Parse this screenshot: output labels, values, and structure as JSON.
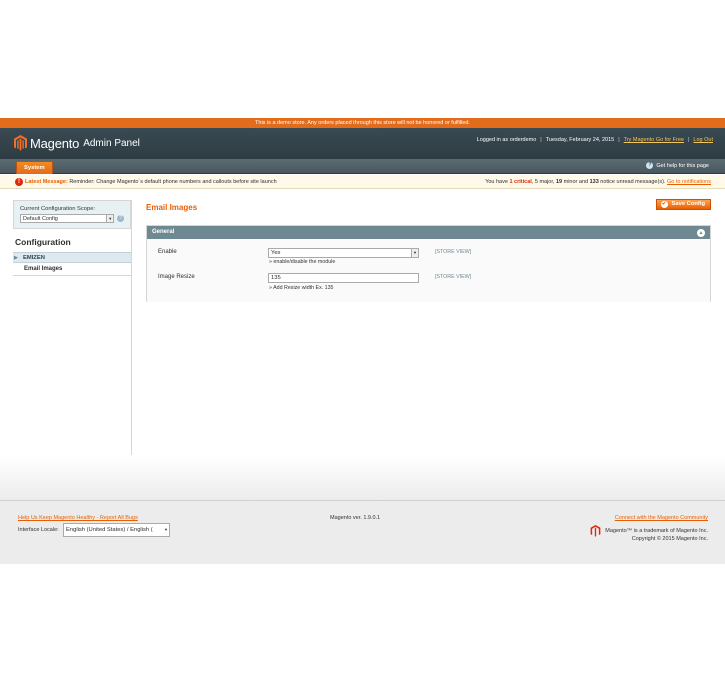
{
  "demo_notice": "This is a demo store. Any orders placed through this store will not be honored or fulfilled.",
  "header": {
    "logo_text": "Magento",
    "logo_sub": "Admin Panel",
    "logged_in": "Logged in as orderdemo",
    "date": "Tuesday, February 24, 2015",
    "try_link": "Try Magento Go for Free",
    "logout_link": "Log Out"
  },
  "nav": {
    "system_tab": "System",
    "help": "Get help for this page"
  },
  "message": {
    "label": "Latest Message:",
    "text": "Reminder: Change Magento`s default phone numbers and callouts before site launch",
    "you_have": "You have",
    "critical_count": "1 critical",
    "major": ", 5 major, ",
    "minor": "19",
    "minor_suffix": " minor and ",
    "notice": "133",
    "notice_suffix": " notice unread message(s).",
    "go_link": "Go to notifications"
  },
  "sidebar": {
    "scope_label": "Current Configuration Scope:",
    "scope_value": "Default Config",
    "title": "Configuration",
    "group": "EMIZEN",
    "item": "Email Images"
  },
  "main": {
    "title": "Email Images",
    "save_label": "Save Config",
    "section": "General",
    "fields": [
      {
        "label": "Enable",
        "value": "Yes",
        "note": "enable/disable the module",
        "scope": "[STORE VIEW]"
      },
      {
        "label": "Image Resize",
        "value": "135",
        "note": "Add Resize width Ex. 135",
        "scope": "[STORE VIEW]"
      }
    ]
  },
  "footer": {
    "help_link": "Help Us Keep Magento Healthy - Report All Bugs",
    "locale_label": "Interface Locale:",
    "locale_value": "English (United States) / English (",
    "version": "Magento ver. 1.9.0.1",
    "community_link": "Connect with the Magento Community",
    "trademark": "Magento™ is a trademark of Magento Inc.",
    "copyright": "Copyright © 2015 Magento Inc."
  },
  "colors": {
    "accent": "#eb5e00",
    "header_bg": "#2e3c43",
    "section_head": "#6f8992"
  }
}
